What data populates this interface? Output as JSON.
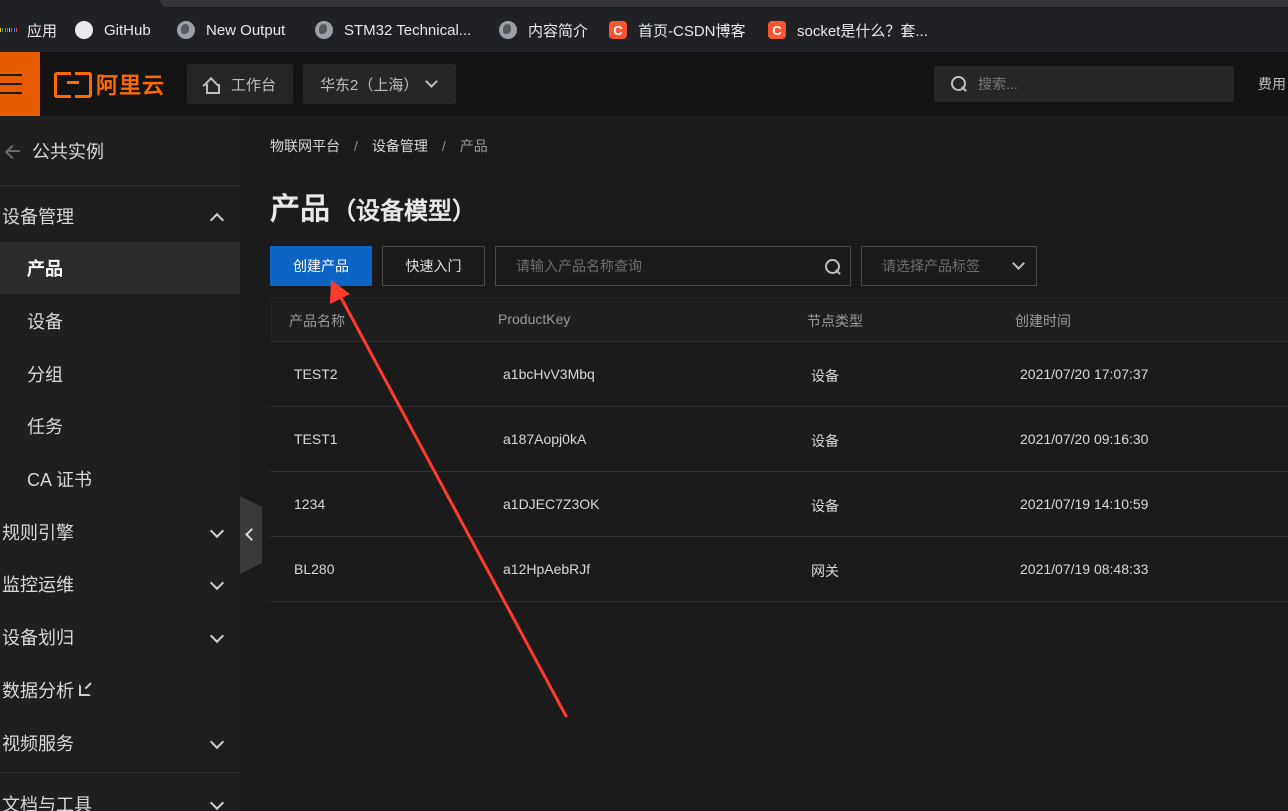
{
  "bookmarks": [
    {
      "label": "应用",
      "icon": "apps-icon"
    },
    {
      "label": "GitHub",
      "icon": "github-icon"
    },
    {
      "label": "New Output",
      "icon": "globe-icon"
    },
    {
      "label": "STM32 Technical...",
      "icon": "globe-icon"
    },
    {
      "label": "内容简介",
      "icon": "globe-icon"
    },
    {
      "label": "首页-CSDN博客",
      "icon": "csdn-icon"
    },
    {
      "label": "socket是什么？套...",
      "icon": "csdn-icon"
    }
  ],
  "topnav": {
    "logo_text": "阿里云",
    "workbench_label": "工作台",
    "region_label": "华东2（上海）",
    "search_placeholder": "搜索...",
    "fee_label": "费用"
  },
  "sidebar": {
    "back_label": "公共实例",
    "items": [
      {
        "label": "设备管理",
        "kind": "group",
        "expanded": true
      },
      {
        "label": "产品",
        "kind": "sub",
        "active": true
      },
      {
        "label": "设备",
        "kind": "sub"
      },
      {
        "label": "分组",
        "kind": "sub"
      },
      {
        "label": "任务",
        "kind": "sub"
      },
      {
        "label": "CA 证书",
        "kind": "sub"
      },
      {
        "label": "规则引擎",
        "kind": "group"
      },
      {
        "label": "监控运维",
        "kind": "group"
      },
      {
        "label": "设备划归",
        "kind": "group"
      },
      {
        "label": "数据分析",
        "kind": "link",
        "external": true
      },
      {
        "label": "视频服务",
        "kind": "group"
      },
      {
        "label": "文档与工具",
        "kind": "group"
      }
    ]
  },
  "main": {
    "breadcrumb": [
      "物联网平台",
      "设备管理",
      "产品"
    ],
    "title": "产品",
    "title_suffix": "（设备模型）",
    "create_button": "创建产品",
    "quickstart_button": "快速入门",
    "name_search_placeholder": "请输入产品名称查询",
    "tag_select_placeholder": "请选择产品标签",
    "table": {
      "headers": [
        "产品名称",
        "ProductKey",
        "节点类型",
        "创建时间"
      ],
      "rows": [
        [
          "TEST2",
          "a1bcHvV3Mbq",
          "设备",
          "2021/07/20 17:07:37"
        ],
        [
          "TEST1",
          "a187Aopj0kA",
          "设备",
          "2021/07/20 09:16:30"
        ],
        [
          "1234",
          "a1DJEC7Z3OK",
          "设备",
          "2021/07/19 14:10:59"
        ],
        [
          "BL280",
          "a12HpAebRJf",
          "网关",
          "2021/07/19 08:48:33"
        ]
      ]
    }
  },
  "colors": {
    "accent_orange": "#ff6a00",
    "primary_blue": "#0c64c4",
    "annotation_red": "#ff3b30"
  }
}
